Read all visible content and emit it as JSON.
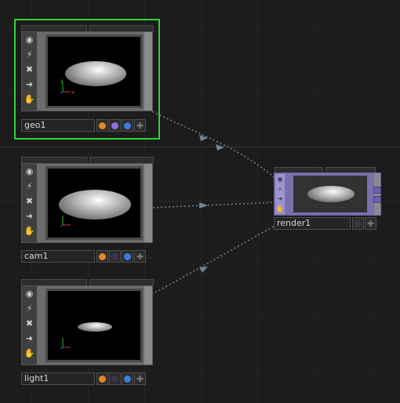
{
  "nodes": {
    "geo1": {
      "name": "geo1",
      "selected": true,
      "flags": [
        "orange",
        "purple",
        "blue",
        "plus"
      ]
    },
    "cam1": {
      "name": "cam1",
      "selected": false,
      "flags": [
        "orange",
        "dark",
        "blue",
        "plus"
      ]
    },
    "light1": {
      "name": "light1",
      "selected": false,
      "flags": [
        "orange",
        "dark",
        "blue",
        "plus"
      ]
    },
    "render1": {
      "name": "render1",
      "selected": false,
      "flags": [
        "dark",
        "plus"
      ]
    }
  },
  "viewer_axes": {
    "x": "x",
    "y": "y"
  },
  "colors": {
    "selected_frame": "#31d231",
    "flag_orange": "#e08a28",
    "flag_purple": "#8d72e0",
    "flag_blue": "#3f7be0",
    "flag_dark": "#3a3648",
    "render_node": "#7c6faf",
    "wire": "#6f8696"
  },
  "icons": [
    "viewer-toggle-icon",
    "cook-icon",
    "bypass-icon",
    "lock-arrow-icon",
    "clone-icon",
    "plus-icon"
  ]
}
